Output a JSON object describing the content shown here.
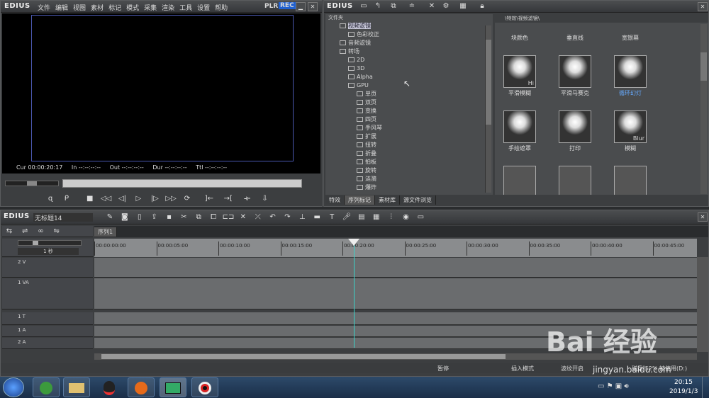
{
  "player": {
    "logo": "EDIUS",
    "menu": [
      "文件",
      "编辑",
      "视图",
      "素材",
      "标记",
      "模式",
      "采集",
      "渲染",
      "工具",
      "设置",
      "帮助"
    ],
    "plr": "PLR",
    "rec": "REC",
    "tc": {
      "cur_label": "Cur",
      "cur": "00:00:20:17",
      "in_label": "In",
      "in": "--:--:--:--",
      "out_label": "Out",
      "out": "--:--:--:--",
      "dur_label": "Dur",
      "dur": "--:--:--:--",
      "ttl_label": "Ttl",
      "ttl": "--:--:--:--"
    }
  },
  "effects": {
    "logo": "EDIUS",
    "tree_header": "文件夹",
    "path": "\\特效\\视频滤镜\\",
    "tree": [
      {
        "label": "视频滤镜",
        "level": 1,
        "selected": true
      },
      {
        "label": "色彩校正",
        "level": 2
      },
      {
        "label": "音频滤镜",
        "level": 1
      },
      {
        "label": "转场",
        "level": 1
      },
      {
        "label": "2D",
        "level": 2
      },
      {
        "label": "3D",
        "level": 2
      },
      {
        "label": "Alpha",
        "level": 2
      },
      {
        "label": "GPU",
        "level": 2
      },
      {
        "label": "单页",
        "level": 3
      },
      {
        "label": "双页",
        "level": 3
      },
      {
        "label": "变换",
        "level": 3
      },
      {
        "label": "四页",
        "level": 3
      },
      {
        "label": "手风琴",
        "level": 3
      },
      {
        "label": "扩展",
        "level": 3
      },
      {
        "label": "扭转",
        "level": 3
      },
      {
        "label": "折叠",
        "level": 3
      },
      {
        "label": "拍板",
        "level": 3
      },
      {
        "label": "旋转",
        "level": 3
      },
      {
        "label": "涟漪",
        "level": 3
      },
      {
        "label": "爆炸",
        "level": 3
      }
    ],
    "thumb_labels_row0": [
      "块颜色",
      "垂直线",
      "宽银幕"
    ],
    "thumbs": [
      {
        "label": "平滑模糊",
        "badge": "Hi"
      },
      {
        "label": "平滑马赛克",
        "badge": ""
      },
      {
        "label": "循环幻灯",
        "badge": "",
        "selected": true
      },
      {
        "label": "手绘遮罩",
        "badge": ""
      },
      {
        "label": "打印",
        "badge": ""
      },
      {
        "label": "模糊",
        "badge": "Blur"
      }
    ],
    "tabs": [
      "特效",
      "序列标记",
      "素材库",
      "源文件浏览"
    ]
  },
  "timeline": {
    "logo": "EDIUS",
    "project": "无标题14",
    "seq_tab": "序列1",
    "scale": "1 秒",
    "ruler": [
      "00:00:00:00",
      "00:00:05:00",
      "00:00:10:00",
      "00:00:15:00",
      "00:00:20:00",
      "00:00:25:00",
      "00:00:30:00",
      "00:00:35:00",
      "00:00:40:00",
      "00:00:45:00"
    ],
    "playhead_fraction": 0.43,
    "tracks": [
      {
        "name": "2 V"
      },
      {
        "name": "1 VA"
      },
      {
        "name": "1 T"
      },
      {
        "name": "1 A"
      },
      {
        "name": "2 A"
      }
    ],
    "status": {
      "pause": "暂停",
      "insert": "插入模式",
      "sync": "波纹开启",
      "disk": "磁盘:52% 被使用(D:)"
    }
  },
  "taskbar": {
    "time": "20:15",
    "date": "2019/1/3"
  },
  "watermark": {
    "text": "Bai 经验",
    "url": "jingyan.baidu.com"
  }
}
